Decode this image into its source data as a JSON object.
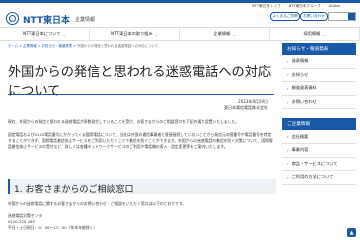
{
  "header": {
    "brand": "NTT東日本",
    "brand_sub": "企業情報",
    "toplinks": [
      "NTT東日本トップ",
      "NTT東日本グループ",
      "Global"
    ],
    "faq_button": "よくあるご質問",
    "contact_button": "お問い合わせ"
  },
  "nav": {
    "items": [
      "NTT東日本について",
      "NTT東日本の取り組み",
      "企業情報",
      "採用情報"
    ]
  },
  "breadcrumb": {
    "items": [
      "ホーム",
      "企業情報",
      "お知らせ・報道発表"
    ],
    "current": "外国からの発信と思われる迷惑電話への対応について"
  },
  "article": {
    "title": "外国からの発信と思われる迷惑電話への対応について",
    "date": "2023年8月29日",
    "org": "東日本電信電話株式会社",
    "para1": "現在、外国からの発信と思われる迷惑電話が多数発生していることを受け、お客さまからのご相談窓口を下記の通り設置いたしました。",
    "para2": "固定電話および0120電話番号にかかってくる国際電話について、当社は外国の通信事業者と直接接続していないことから発信元の国番号や電話番号を特定することができず、国際電話着信休止サービスをご利用いただくことで着信を防ぐことができます。外国からの迷惑電話の着信を防ぐ対策について、国際電話着信休止サービスの受付など、詳しくは各種ネットワークサービスのご利用や電話機の導入・設定変更等をご案内いたします。",
    "section_title": "1. お客さまからのご相談窓口",
    "section_lead": "外国からの迷惑電話に関するお客さまからのお問い合わせ・ご相談をいただく窓口は以下のとおりです。",
    "contact_name": "迷惑電話対策センタ",
    "contact_phone": "0120-325-263",
    "contact_hours": "平日・土日祝日：9：00～17：00（年末年始除く）"
  },
  "sidebar": {
    "group1_head": "お知らせ・報道発表",
    "group1_items": [
      "発表情報",
      "お知らせ",
      "報道発表資料",
      "お問い合わせ"
    ],
    "group2_head": "ご企業情報",
    "group2_items": [
      "会社概要",
      "事業内容",
      "商品・サービスについて",
      "ご利用の方法について"
    ]
  },
  "icons": {
    "search": "search-icon",
    "page_top": "arrow-up-icon"
  },
  "colors": {
    "brand_blue": "#1a59a8"
  }
}
